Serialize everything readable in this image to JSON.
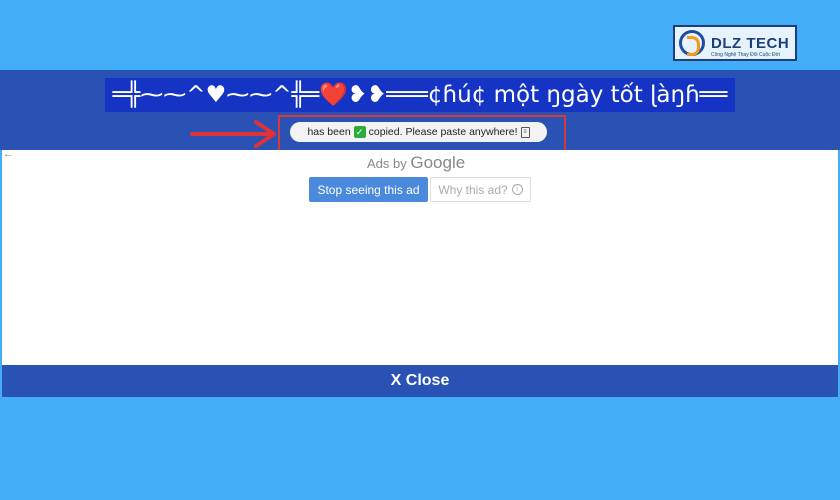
{
  "logo": {
    "name": "DLZ TECH",
    "tagline": "Công Nghệ Thay Đổi Cuộc Đời"
  },
  "banner": {
    "text": "═╬⁓⁓^♥⁓⁓^╬═❤️❥❥═══¢ɦú¢ một ŋgày tốt ɭàŋɦ══"
  },
  "toast": {
    "prefix": "has been",
    "check_glyph": "✓",
    "message": "copied. Please paste anywhere!"
  },
  "ad": {
    "ads_by": "Ads by",
    "google": "Google",
    "stop_label": "Stop seeing this ad",
    "why_label": "Why this ad?",
    "back_glyph": "←"
  },
  "close": {
    "label": "X Close"
  },
  "colors": {
    "page_bg": "#44adf7",
    "band": "#2a52b5",
    "banner_bg": "#1534c4",
    "highlight": "#d9383a"
  }
}
